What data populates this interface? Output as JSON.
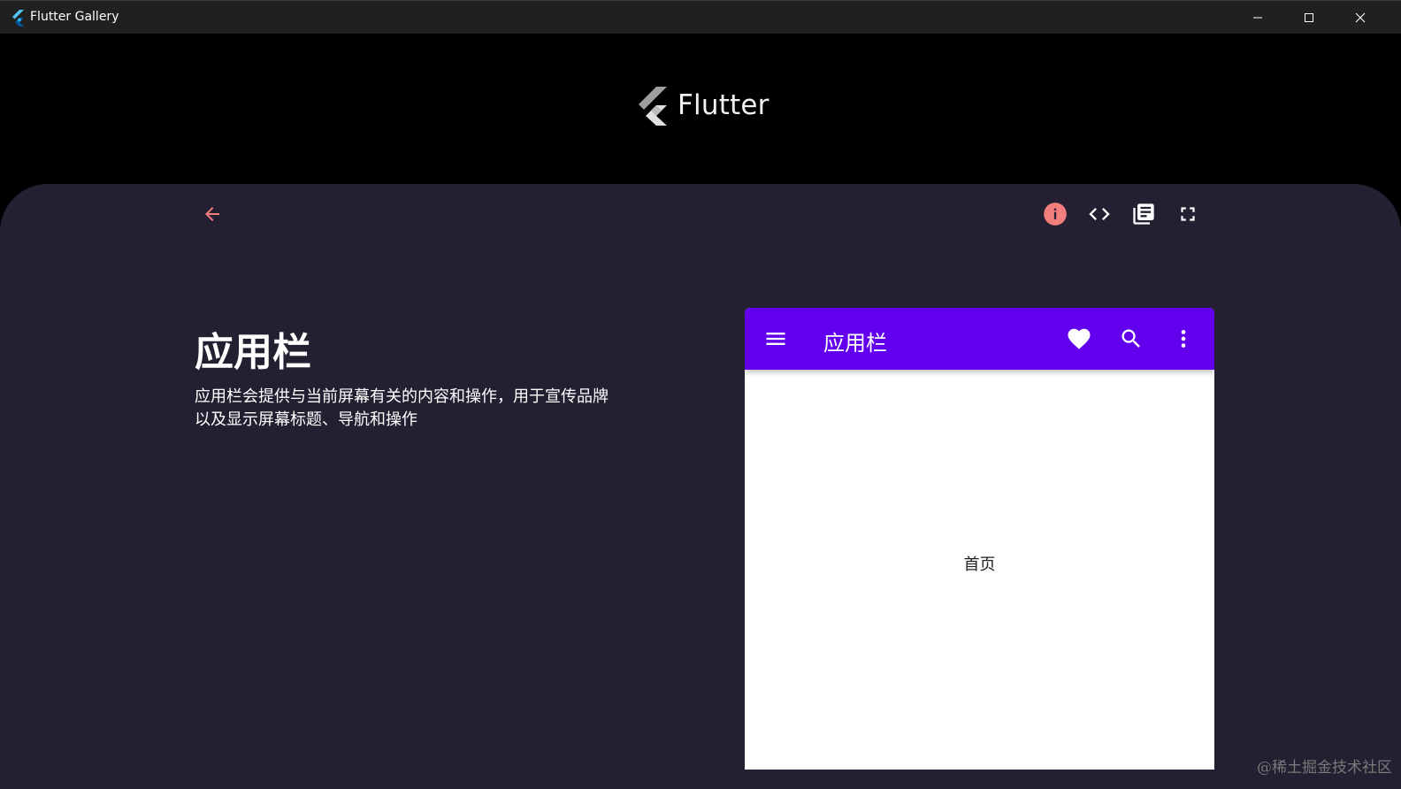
{
  "window": {
    "title": "Flutter Gallery",
    "controls": [
      "minimize-icon",
      "maximize-icon",
      "close-icon"
    ]
  },
  "header": {
    "brand_name": "Flutter",
    "logo_icon": "flutter-logo-icon"
  },
  "toolbar": {
    "back_icon": "arrow-back-icon",
    "actions": [
      "info-icon",
      "code-icon",
      "library-books-icon",
      "fullscreen-icon"
    ]
  },
  "demo": {
    "title": "应用栏",
    "description": "应用栏会提供与当前屏幕有关的内容和操作，用于宣传品牌以及显示屏幕标题、导航和操作"
  },
  "preview": {
    "appbar_title": "应用栏",
    "appbar_icons": [
      "menu-icon",
      "favorite-icon",
      "search-icon",
      "more-vert-icon"
    ],
    "body_text": "首页"
  },
  "watermark": "@稀土掘金技术社区",
  "colors": {
    "panel_bg": "#241f31",
    "accent": "#f47e7e",
    "appbar": "#6200ee",
    "header_bg": "#000000"
  }
}
